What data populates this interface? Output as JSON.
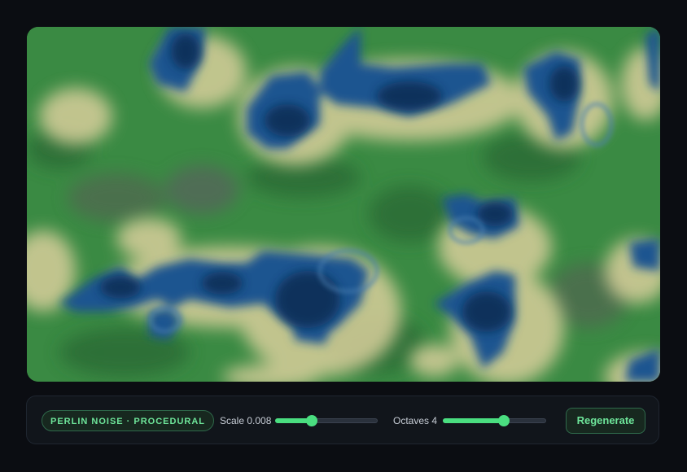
{
  "canvas": {
    "description_icon": "terrain-noise-map",
    "palette": {
      "deep_water": "#0f2f57",
      "water": "#1f5590",
      "shallow": "#4a7fb0",
      "sand": "#d9cf9b",
      "grass": "#3a8a43",
      "forest": "#2c6b36",
      "rock": "#566a56"
    }
  },
  "toolbar": {
    "badge_label": "PERLIN NOISE · PROCEDURAL",
    "scale_label": "Scale 0.008",
    "scale_level": 0.36,
    "octaves_label": "Octaves 4",
    "octaves_level": 0.59,
    "regenerate_label": "Regenerate",
    "accent_color": "#4ade80"
  }
}
